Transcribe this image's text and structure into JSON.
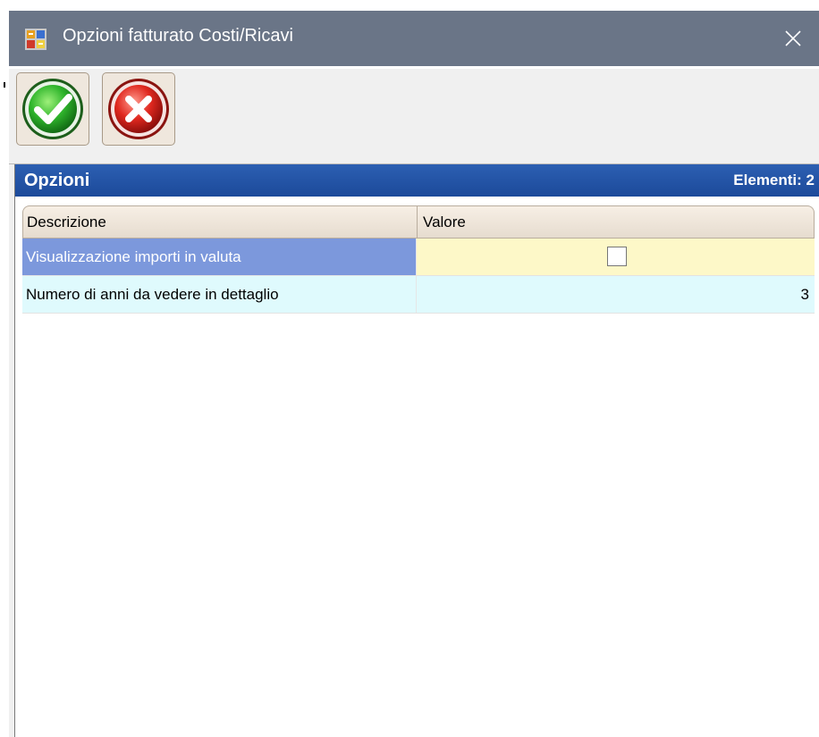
{
  "window": {
    "title": "Opzioni fatturato Costi/Ricavi",
    "icon": "app-grid-icon",
    "close_icon": "close-icon"
  },
  "toolbar": {
    "buttons": [
      {
        "name": "ok",
        "icon": "green-check-icon"
      },
      {
        "name": "cancel",
        "icon": "red-x-icon"
      }
    ]
  },
  "panel": {
    "title": "Opzioni",
    "count_label": "Elementi: 2"
  },
  "grid": {
    "columns": [
      "Descrizione",
      "Valore"
    ],
    "rows": [
      {
        "description": "Visualizzazione importi in valuta",
        "value_type": "checkbox",
        "checked": false
      },
      {
        "description": "Numero di anni da vedere in dettaglio",
        "value_type": "number",
        "value": "3"
      }
    ]
  },
  "colors": {
    "titlebar": "#6a7587",
    "panel_header": "#2c5fb2",
    "selected_row": "#7c98dc",
    "value_cell_highlight": "#fdf8c8",
    "row_alt": "#dffafd"
  }
}
